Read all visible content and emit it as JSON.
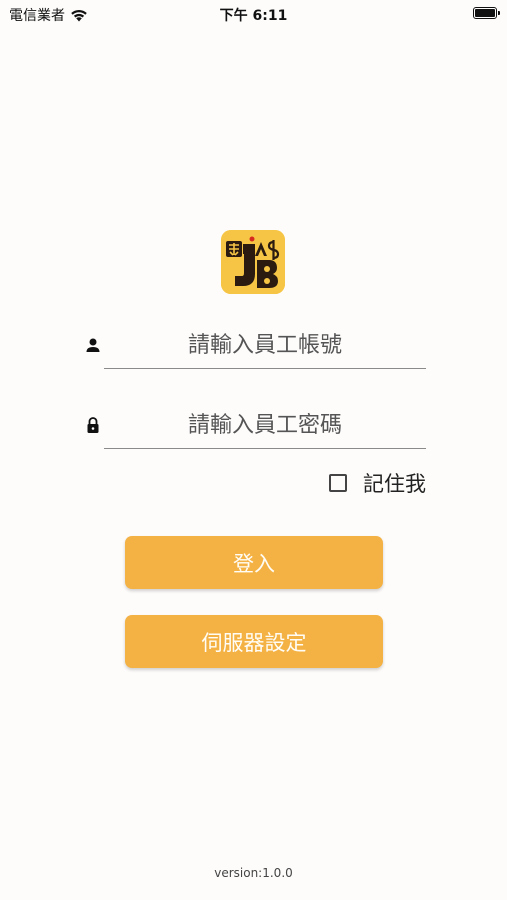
{
  "status_bar": {
    "carrier": "電信業者",
    "time": "下午 6:11",
    "battery_level": 1.0
  },
  "logo": {
    "icon": "app-logo-icon",
    "brand_color": "#f6c545"
  },
  "login_form": {
    "account_placeholder": "請輸入員工帳號",
    "account_value": "",
    "password_placeholder": "請輸入員工密碼",
    "password_value": "",
    "remember_label": "記住我",
    "remember_checked": false,
    "login_label": "登入",
    "server_settings_label": "伺服器設定"
  },
  "footer": {
    "version": "version:1.0.0"
  },
  "colors": {
    "button": "#f4b245",
    "background": "#fdfcfb"
  }
}
